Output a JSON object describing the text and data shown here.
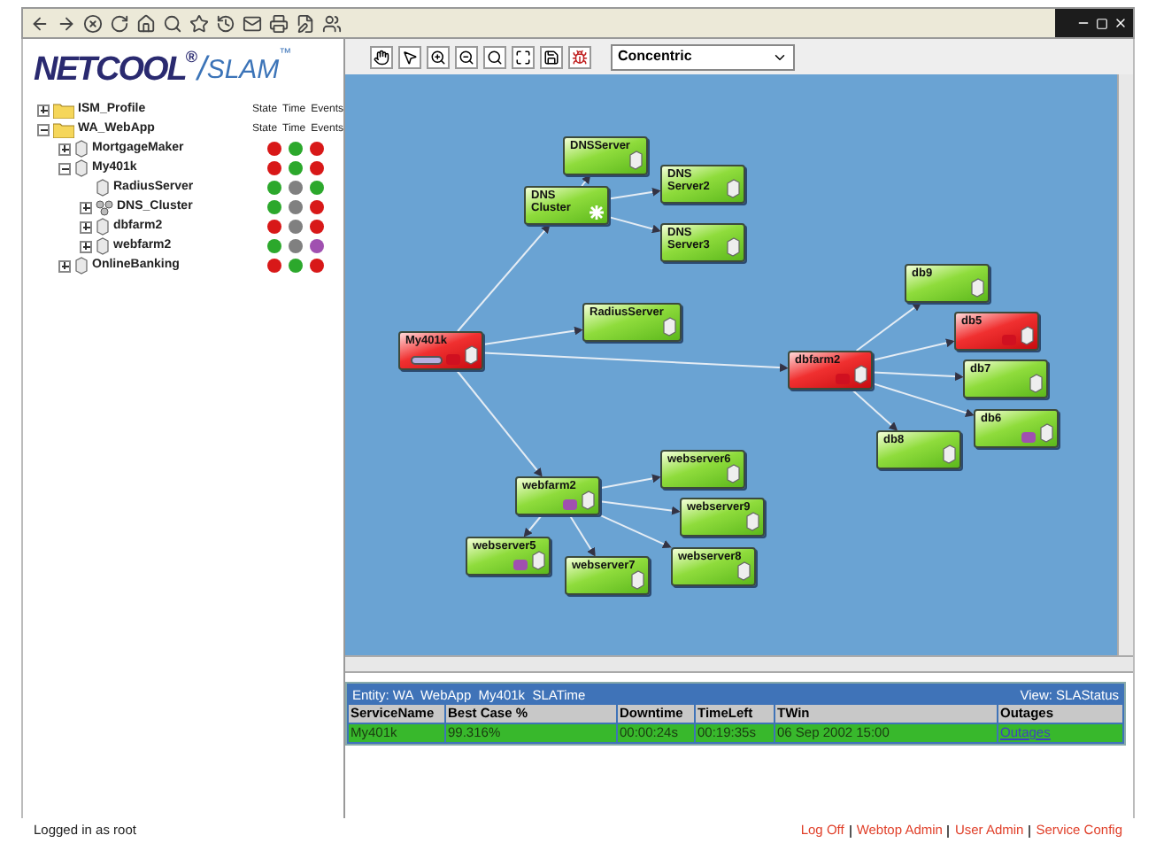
{
  "logo": {
    "brand": "NETCOOL",
    "reg": "®",
    "slash": "/",
    "product": "SLAM",
    "tm": "™"
  },
  "tree": {
    "items": [
      {
        "label": "ISM_Profile",
        "kind": "folder",
        "expanded": false,
        "header": [
          "State",
          "Time",
          "Events"
        ]
      },
      {
        "label": "WA_WebApp",
        "kind": "folder",
        "expanded": true,
        "header": [
          "State",
          "Time",
          "Events"
        ],
        "children": [
          {
            "label": "MortgageMaker",
            "kind": "server",
            "expanded": false,
            "statuses": [
              {
                "color": "#d81818"
              },
              {
                "color": "#2ca82c"
              },
              {
                "color": "#d81818"
              }
            ]
          },
          {
            "label": "My401k",
            "kind": "server",
            "expanded": true,
            "statuses": [
              {
                "color": "#d81818"
              },
              {
                "color": "#2ca82c"
              },
              {
                "color": "#d81818"
              }
            ],
            "children": [
              {
                "label": "RadiusServer",
                "kind": "server",
                "statuses": [
                  {
                    "color": "#2ca82c"
                  },
                  {
                    "color": "#808080"
                  },
                  {
                    "color": "#2ca82c"
                  }
                ]
              },
              {
                "label": "DNS_Cluster",
                "kind": "cluster",
                "expanded": false,
                "statuses": [
                  {
                    "color": "#2ca82c"
                  },
                  {
                    "color": "#808080"
                  },
                  {
                    "color": "#d81818"
                  }
                ]
              },
              {
                "label": "dbfarm2",
                "kind": "server",
                "expanded": false,
                "statuses": [
                  {
                    "color": "#d81818"
                  },
                  {
                    "color": "#808080"
                  },
                  {
                    "color": "#d81818"
                  }
                ]
              },
              {
                "label": "webfarm2",
                "kind": "server",
                "expanded": false,
                "statuses": [
                  {
                    "color": "#2ca82c"
                  },
                  {
                    "color": "#808080"
                  },
                  {
                    "color": "#a050b0"
                  }
                ]
              }
            ]
          },
          {
            "label": "OnlineBanking",
            "kind": "server",
            "expanded": false,
            "statuses": [
              {
                "color": "#d81818"
              },
              {
                "color": "#2ca82c"
              },
              {
                "color": "#d81818"
              }
            ]
          }
        ]
      }
    ]
  },
  "graph_toolbar": {
    "layout_select": {
      "value": "Concentric"
    }
  },
  "graph": {
    "nodes": [
      {
        "label": "My401k",
        "critical": true,
        "kind": "server",
        "badges": [
          {
            "kind": "bar",
            "color": "#b8b0e0"
          },
          {
            "kind": "dot",
            "color": "#d01020"
          }
        ],
        "children": [
          {
            "label": "DNS Cluster",
            "critical": false,
            "kind": "cluster",
            "children": [
              {
                "label": "DNSServer",
                "critical": false,
                "kind": "server"
              },
              {
                "label": "DNS Server2",
                "critical": false,
                "kind": "server"
              },
              {
                "label": "DNS Server3",
                "critical": false,
                "kind": "server"
              }
            ]
          },
          {
            "label": "RadiusServer",
            "critical": false,
            "kind": "server"
          },
          {
            "label": "dbfarm2",
            "critical": true,
            "kind": "server",
            "badges": [
              {
                "kind": "dot",
                "color": "#d01020"
              }
            ],
            "children": [
              {
                "label": "db9",
                "critical": false,
                "kind": "server"
              },
              {
                "label": "db5",
                "critical": true,
                "kind": "server",
                "badges": [
                  {
                    "kind": "dot",
                    "color": "#d01020"
                  }
                ]
              },
              {
                "label": "db7",
                "critical": false,
                "kind": "server"
              },
              {
                "label": "db6",
                "critical": false,
                "kind": "server",
                "badges": [
                  {
                    "kind": "dot",
                    "color": "#a050b0"
                  }
                ]
              },
              {
                "label": "db8",
                "critical": false,
                "kind": "server"
              }
            ]
          },
          {
            "label": "webfarm2",
            "critical": false,
            "kind": "server",
            "badges": [
              {
                "kind": "dot",
                "color": "#a050b0"
              }
            ],
            "children": [
              {
                "label": "webserver6",
                "critical": false,
                "kind": "server"
              },
              {
                "label": "webserver9",
                "critical": false,
                "kind": "server"
              },
              {
                "label": "webserver8",
                "critical": false,
                "kind": "server"
              },
              {
                "label": "webserver5",
                "critical": false,
                "kind": "server",
                "badges": [
                  {
                    "kind": "dot",
                    "color": "#a050b0"
                  }
                ]
              },
              {
                "label": "webserver7",
                "critical": false,
                "kind": "server"
              }
            ]
          }
        ]
      }
    ]
  },
  "sla_panel": {
    "entity": "Entity: WA  WebApp  My401k  SLATime",
    "view": "View: SLAStatus",
    "columns": [
      "ServiceName",
      "Best Case %",
      "Downtime",
      "TimeLeft",
      "TWin",
      "Outages"
    ],
    "rows": [
      {
        "cells": [
          "My401k",
          "99.316%",
          "00:00:24s",
          "00:19:35s",
          "06 Sep 2002 15:00"
        ],
        "link": "Outages"
      }
    ]
  },
  "status_bar": {
    "login": "Logged in as root",
    "links": [
      "Log Off",
      "Webtop Admin",
      "User Admin",
      "Service Config"
    ]
  }
}
